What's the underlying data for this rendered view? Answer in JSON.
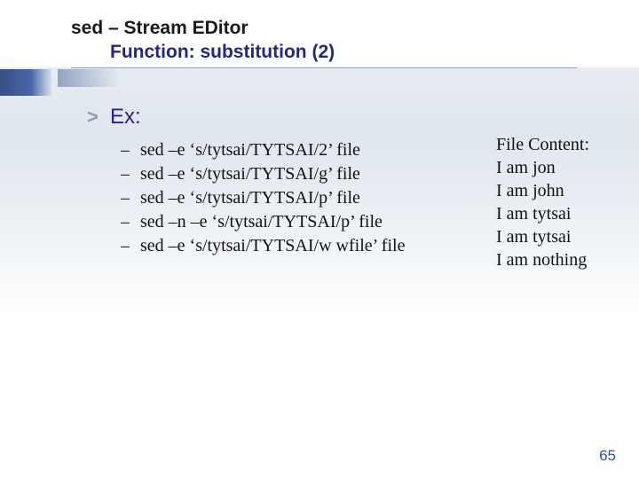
{
  "title": {
    "line1": "sed – Stream EDitor",
    "line2": "Function: substitution (2)"
  },
  "section_label": "Ex:",
  "commands": [
    "sed –e ‘s/tytsai/TYTSAI/2’ file",
    "sed –e ‘s/tytsai/TYTSAI/g’ file",
    "sed –e ‘s/tytsai/TYTSAI/p’ file",
    "sed –n –e ‘s/tytsai/TYTSAI/p’ file",
    "sed –e ‘s/tytsai/TYTSAI/w wfile’ file"
  ],
  "file_content": {
    "heading": "File Content:",
    "lines": [
      "I am jon",
      "I am john",
      "I am tytsai",
      "I am tytsai",
      "I am nothing"
    ]
  },
  "page_number": "65"
}
